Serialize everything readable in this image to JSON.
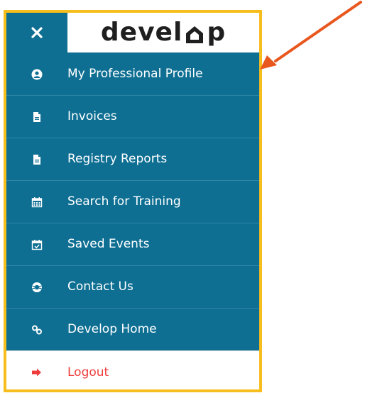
{
  "colors": {
    "menu_background": "#0e6f93",
    "menu_divider": "#2f86a6",
    "frame_border": "#f7bd1c",
    "arrow": "#e8571e",
    "logout_text": "#ef3b3b",
    "text_light": "#ffffff",
    "logo_text": "#1f1f1f"
  },
  "header": {
    "close_icon": "close-icon",
    "logo_before": "devel",
    "logo_mark": "house-o-icon",
    "logo_after": "p"
  },
  "menu": {
    "items": [
      {
        "label": "My Professional Profile",
        "icon": "user-circle-icon"
      },
      {
        "label": "Invoices",
        "icon": "document-icon"
      },
      {
        "label": "Registry Reports",
        "icon": "document-icon"
      },
      {
        "label": "Search for Training",
        "icon": "calendar-icon"
      },
      {
        "label": "Saved Events",
        "icon": "calendar-check-icon"
      },
      {
        "label": "Contact Us",
        "icon": "life-ring-icon"
      },
      {
        "label": "Develop Home",
        "icon": "link-icon"
      }
    ],
    "logout": {
      "label": "Logout",
      "icon": "sign-out-icon"
    }
  }
}
